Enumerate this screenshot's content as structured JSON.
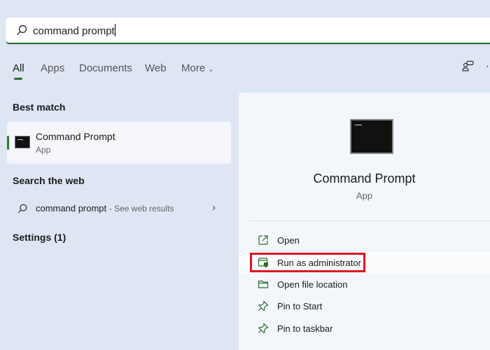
{
  "search": {
    "query": "command prompt"
  },
  "tabs": [
    {
      "label": "All"
    },
    {
      "label": "Apps"
    },
    {
      "label": "Documents"
    },
    {
      "label": "Web"
    },
    {
      "label": "More"
    }
  ],
  "best_match": {
    "heading": "Best match",
    "title": "Command Prompt",
    "subtitle": "App"
  },
  "web": {
    "heading": "Search the web",
    "query": "command prompt",
    "suffix": "- See web results"
  },
  "settings": {
    "heading": "Settings (1)"
  },
  "detail": {
    "title": "Command Prompt",
    "subtitle": "App",
    "actions": [
      {
        "label": "Open"
      },
      {
        "label": "Run as administrator"
      },
      {
        "label": "Open file location"
      },
      {
        "label": "Pin to Start"
      },
      {
        "label": "Pin to taskbar"
      }
    ]
  },
  "colors": {
    "accent": "#2c6b2f",
    "highlight": "#e0141e"
  }
}
